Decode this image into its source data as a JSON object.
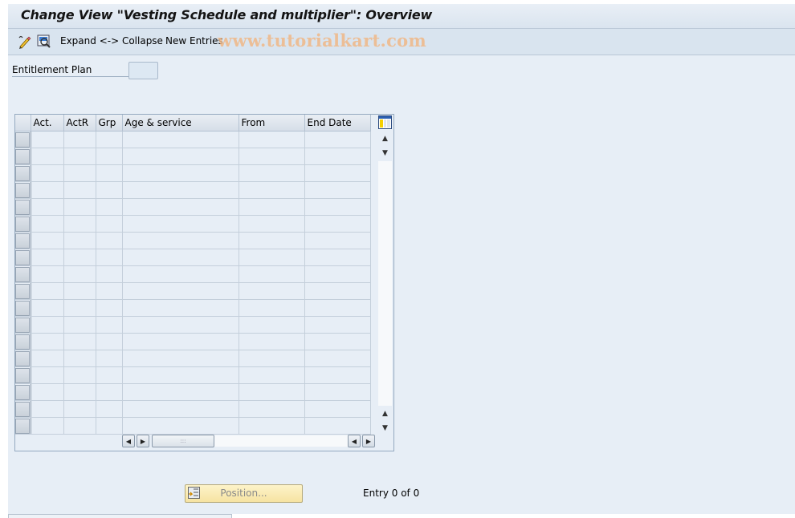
{
  "window": {
    "title": "Change View \"Vesting Schedule and multiplier\": Overview"
  },
  "toolbar": {
    "icons": [
      "display-change-icon",
      "details-icon"
    ],
    "expand_collapse_label": "Expand <-> Collapse",
    "new_entries_label": "New Entries",
    "watermark": "www.tutorialkart.com"
  },
  "form": {
    "entitlement_plan_label": "Entitlement Plan",
    "entitlement_plan_value": ""
  },
  "table": {
    "columns": [
      "Act.",
      "ActR",
      "Grp",
      "Age & service",
      "From",
      "End Date"
    ],
    "row_count": 18,
    "rows": []
  },
  "footer": {
    "position_button_label": "Position...",
    "entry_info": "Entry 0 of 0"
  },
  "colors": {
    "background": "#e7eef6",
    "toolbar": "#d9e4ef",
    "position_button": "#f8e8ae",
    "watermark": "#f0b887"
  }
}
